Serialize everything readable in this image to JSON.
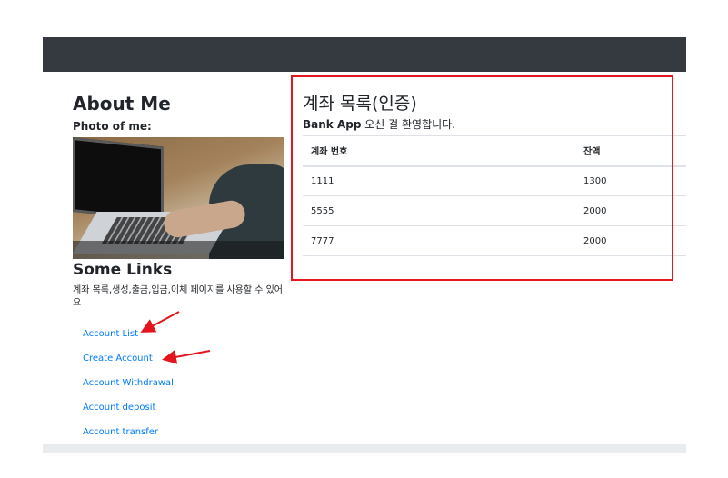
{
  "sidebar": {
    "about_title": "About Me",
    "photo_label": "Photo of me:",
    "links_title": "Some Links",
    "links_desc": "계좌 목록,생성,출금,입금,이체 페이지를 사용할 수 있어요",
    "links": [
      {
        "label": "Account List"
      },
      {
        "label": "Create Account"
      },
      {
        "label": "Account Withdrawal"
      },
      {
        "label": "Account deposit"
      },
      {
        "label": "Account transfer"
      }
    ]
  },
  "main": {
    "title": "계좌 목록(인증)",
    "welcome_bold": "Bank App",
    "welcome_rest": " 오신 걸 환영합니다.",
    "table": {
      "headers": [
        "계좌 번호",
        "잔액"
      ],
      "rows": [
        [
          "1111",
          "1300"
        ],
        [
          "5555",
          "2000"
        ],
        [
          "7777",
          "2000"
        ]
      ]
    }
  },
  "colors": {
    "navbar": "#343a40",
    "link": "#007bff",
    "annotation": "#e3161d"
  }
}
